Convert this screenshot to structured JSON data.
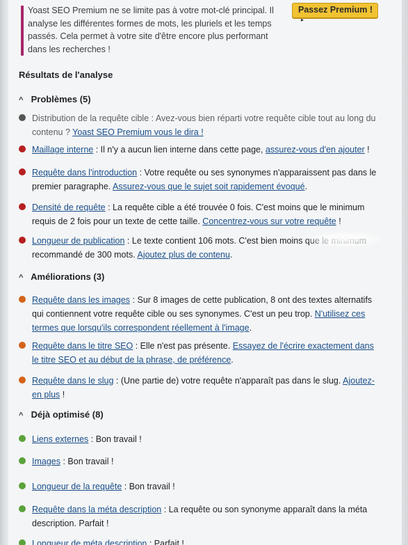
{
  "upsell": {
    "message": "Yoast SEO Premium ne se limite pas à votre mot-clé principal. Il analyse les différentes formes de mots, les pluriels et les temps passés. Cela permet à votre site d'être encore plus performant dans les recherches !",
    "button_label": "Passez Premium !",
    "button_caret": "▸"
  },
  "results_title": "Résultats de l'analyse",
  "sections": {
    "problems": {
      "chevron": "^",
      "label": "Problèmes (5)"
    },
    "improvements": {
      "chevron": "^",
      "label": "Améliorations (3)"
    },
    "good": {
      "chevron": "^",
      "label": "Déjà optimisé (8)"
    }
  },
  "problems": [
    {
      "text": "Distribution de la requête cible : Avez-vous bien réparti votre requête cible tout au long du contenu ? ",
      "link": "Yoast SEO Premium vous le dira !"
    },
    {
      "title": "Maillage interne",
      "text": " : Il n'y a aucun lien interne dans cette page, ",
      "link": "assurez-vous d'en ajouter",
      "tail": " !"
    },
    {
      "title": "Requête dans l'introduction",
      "text": " : Votre requête ou ses synonymes n'apparaissent pas dans le premier paragraphe. ",
      "link": "Assurez-vous que le sujet soit rapidement évoqué",
      "tail": "."
    },
    {
      "title": "Densité de requête",
      "text": " : La requête cible a été trouvée 0 fois. C'est moins que le minimum requis de 2 fois pour un texte de cette taille. ",
      "link": "Concentrez-vous sur votre requête",
      "tail": " !"
    },
    {
      "title": "Longueur de publication",
      "text": " : Le texte contient 106 mots. C'est bien moins que le minimum recommandé de 300 mots. ",
      "link": "Ajoutez plus de contenu",
      "tail": "."
    }
  ],
  "improvements": [
    {
      "title": "Requête dans les images",
      "text": " : Sur 8 images de cette publication, 8 ont des textes alternatifs qui contiennent votre requête cible ou ses synonymes. C'est un peu trop. ",
      "link": "N'utilisez ces termes que lorsqu'ils correspondent réellement à l'image",
      "tail": "."
    },
    {
      "title": "Requête dans le titre SEO",
      "text": " : Elle n'est pas présente. ",
      "link": "Essayez de l'écrire exactement dans le titre SEO et au début de la phrase, de préférence",
      "tail": "."
    },
    {
      "title": "Requête dans le slug",
      "text": " : (Une partie de) votre requête n'apparaît pas dans le slug. ",
      "link": "Ajoutez-en plus",
      "tail": " !"
    }
  ],
  "good": [
    {
      "title": "Liens externes",
      "text": " : Bon travail !"
    },
    {
      "title": "Images",
      "text": " : Bon travail !"
    },
    {
      "title": "Longueur de la requête",
      "text": " : Bon travail !"
    },
    {
      "title": "Requête dans la méta description",
      "text": " : La requête ou son synonyme apparaît dans la méta description. Parfait !"
    },
    {
      "title": "Longueur de méta description",
      "text": " : Parfait !"
    }
  ],
  "colors": {
    "problem": "#b5201f",
    "improvement": "#d4631a",
    "good": "#5aa23a",
    "link": "#1a4f8a",
    "premium": "#f1c232",
    "upsell_bar": "#a4286a"
  }
}
